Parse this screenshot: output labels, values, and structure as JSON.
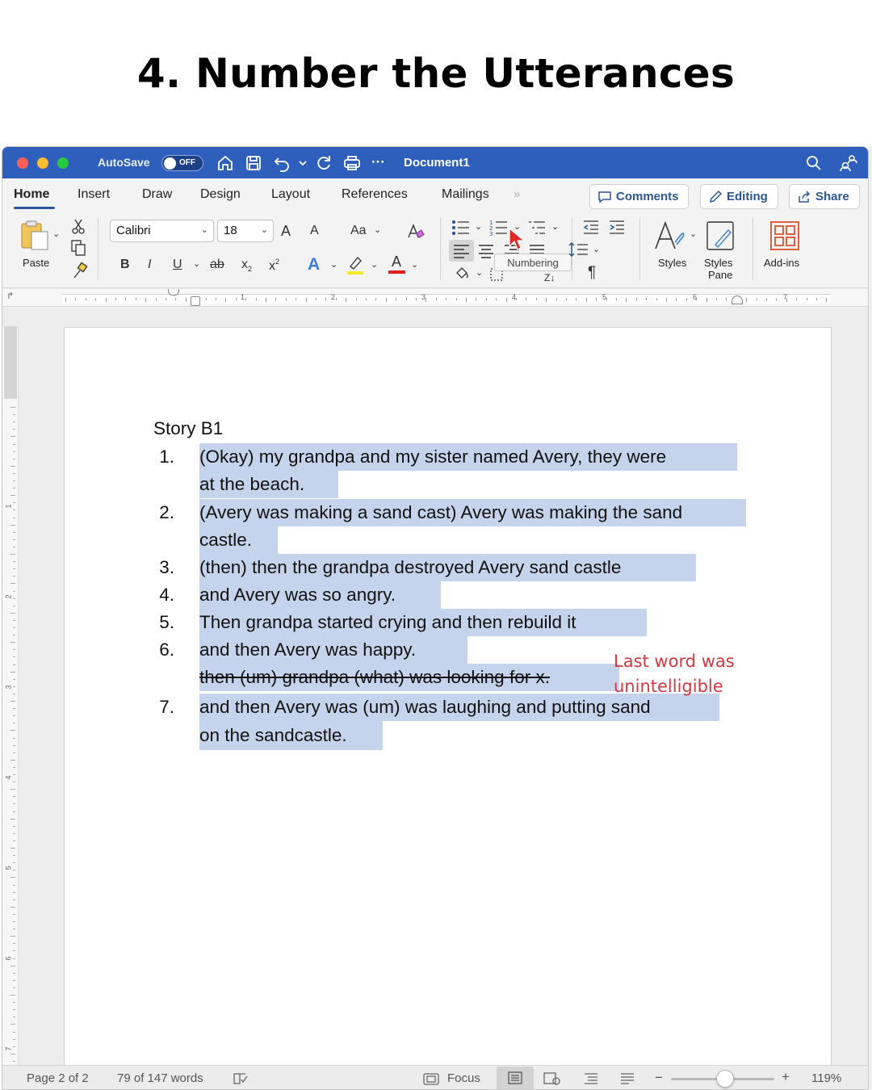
{
  "slide": {
    "title": "4. Number the Utterances"
  },
  "titlebar": {
    "autosave_label": "AutoSave",
    "autosave_state": "OFF",
    "document_name": "Document1",
    "more": "···",
    "icons": [
      "home-icon",
      "save-icon",
      "undo-icon",
      "redo-icon",
      "print-icon",
      "search-icon",
      "share-people-icon"
    ]
  },
  "tabs": {
    "items": [
      "Home",
      "Insert",
      "Draw",
      "Design",
      "Layout",
      "References",
      "Mailings"
    ],
    "active": "Home",
    "more": "»",
    "comments_label": "Comments",
    "editing_label": "Editing",
    "share_label": "Share"
  },
  "ribbon": {
    "paste_label": "Paste",
    "font_name": "Calibri",
    "font_size": "18",
    "grow_font": "A",
    "shrink_font": "A",
    "change_case": "Aa",
    "bold": "B",
    "italic": "I",
    "underline": "U",
    "strikethrough": "ab",
    "subscript": "x",
    "superscript": "x",
    "text_effects": "A",
    "font_color": "A",
    "pilcrow": "¶",
    "sort": "Z",
    "tooltip": "Numbering",
    "styles_label": "Styles",
    "styles_pane_label_1": "Styles",
    "styles_pane_label_2": "Pane",
    "addins_label": "Add-ins",
    "highlight_color": "#f5e829",
    "font_color_bar": "#e11d1d"
  },
  "ruler": {
    "numbers": [
      "1",
      "2",
      "3",
      "4",
      "5",
      "6",
      "7"
    ]
  },
  "vruler": {
    "numbers": [
      "1",
      "2",
      "3",
      "4",
      "5",
      "6",
      "7"
    ]
  },
  "document": {
    "heading": "Story B1",
    "utterances": [
      {
        "num": "1.",
        "lines": [
          "(Okay) my grandpa and my sister named Avery, they were",
          "at the beach."
        ]
      },
      {
        "num": "2.",
        "lines": [
          "(Avery was making a sand cast) Avery was making the sand",
          "castle."
        ]
      },
      {
        "num": "3.",
        "lines": [
          "(then) then the grandpa destroyed Avery sand castle"
        ]
      },
      {
        "num": "4.",
        "lines": [
          "and Avery was so angry."
        ]
      },
      {
        "num": "5.",
        "lines": [
          "Then grandpa started crying and then rebuild it"
        ]
      },
      {
        "num": "6.",
        "lines": [
          "and then Avery was happy."
        ]
      },
      {
        "num": "7.",
        "lines": [
          "and then Avery was (um) was laughing and putting sand",
          "on the sandcastle."
        ]
      }
    ],
    "struck_line": "then (um) grandpa (what) was looking for x.",
    "annotation_line1": "Last word was",
    "annotation_line2": "unintelligible",
    "highlight_color": "#c5d3ec",
    "annotation_color": "#d9363e"
  },
  "statusbar": {
    "page": "Page 2 of 2",
    "words": "79 of 147 words",
    "focus": "Focus",
    "zoom_minus": "−",
    "zoom_plus": "+",
    "zoom": "119%"
  }
}
